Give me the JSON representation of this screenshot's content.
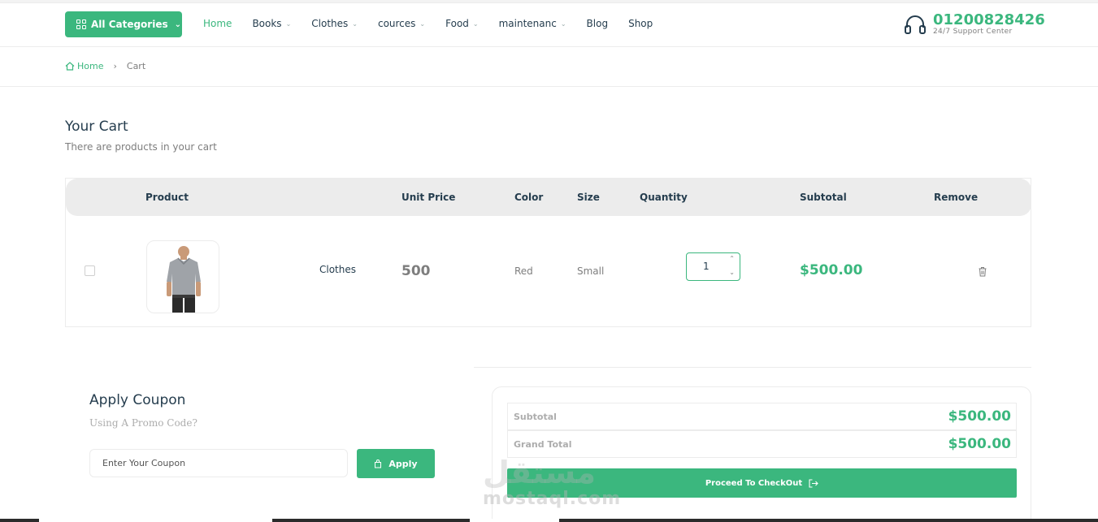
{
  "header": {
    "all_categories": "All Categories",
    "nav": [
      {
        "label": "Home",
        "dropdown": false,
        "active": true
      },
      {
        "label": "Books",
        "dropdown": true
      },
      {
        "label": "Clothes",
        "dropdown": true
      },
      {
        "label": "cources",
        "dropdown": true
      },
      {
        "label": "Food",
        "dropdown": true
      },
      {
        "label": "maintenanc",
        "dropdown": true
      },
      {
        "label": "Blog",
        "dropdown": false
      },
      {
        "label": "Shop",
        "dropdown": false
      }
    ],
    "phone": "01200828426",
    "support_text": "24/7 Support Center"
  },
  "breadcrumb": {
    "home": "Home",
    "separator": "›",
    "current": "Cart"
  },
  "cart": {
    "title": "Your Cart",
    "subtitle": "There are products in your cart",
    "columns": {
      "product": "Product",
      "unit_price": "Unit Price",
      "color": "Color",
      "size": "Size",
      "quantity": "Quantity",
      "subtotal": "Subtotal",
      "remove": "Remove"
    },
    "items": [
      {
        "name": "Clothes",
        "unit_price": "500",
        "color": "Red",
        "size": "Small",
        "quantity": "1",
        "subtotal": "$500.00",
        "checked": false
      }
    ]
  },
  "coupon": {
    "title": "Apply Coupon",
    "subtitle": "Using A Promo Code?",
    "placeholder": "Enter Your Coupon",
    "button": "Apply"
  },
  "totals": {
    "subtotal_label": "Subtotal",
    "subtotal_value": "$500.00",
    "grand_label": "Grand Total",
    "grand_value": "$500.00",
    "checkout": "Proceed To CheckOut"
  },
  "watermark": {
    "arabic": "مستقل",
    "latin": "mostaql.com"
  },
  "colors": {
    "accent": "#3bb77e",
    "text": "#253d4e",
    "muted": "#7e7e7e"
  }
}
